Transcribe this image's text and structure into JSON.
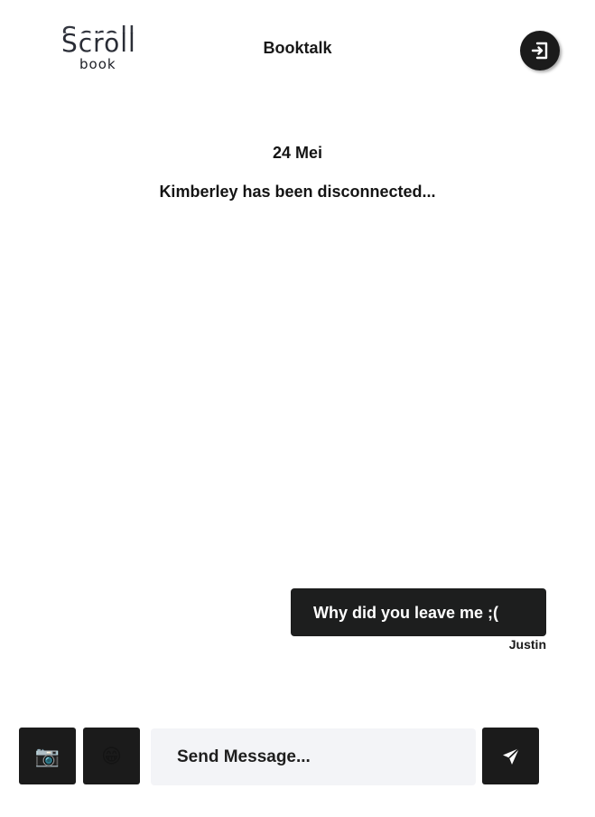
{
  "header": {
    "logo_top": "Scroll",
    "logo_bottom": "book",
    "title": "Booktalk",
    "logout_icon": "logout-icon"
  },
  "conversation": {
    "date": "24 Mei",
    "system_message": "Kimberley has been disconnected...",
    "messages": [
      {
        "text": "Why did you leave me ;(",
        "sender": "Justin"
      }
    ]
  },
  "composer": {
    "camera_emoji": "📷",
    "emoji_button": "😁",
    "placeholder": "Send Message...",
    "send_icon": "send-icon"
  },
  "colors": {
    "accent": "#1b1b1b",
    "input_background": "#f3f4f7",
    "background": "#ffffff"
  }
}
